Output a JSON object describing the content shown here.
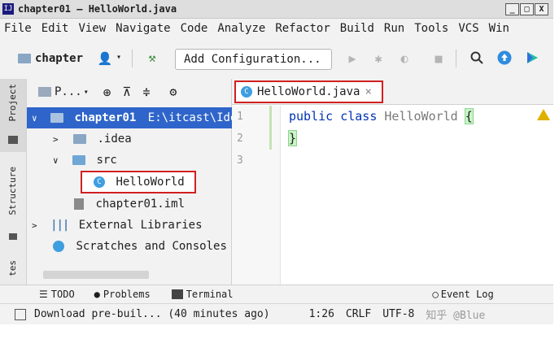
{
  "window": {
    "title": "chapter01 – HelloWorld.java",
    "min_label": "_",
    "max_label": "□",
    "close_label": "X"
  },
  "menu": [
    "File",
    "Edit",
    "View",
    "Navigate",
    "Code",
    "Analyze",
    "Refactor",
    "Build",
    "Run",
    "Tools",
    "VCS",
    "Win"
  ],
  "toolbar": {
    "project_label": "chapter",
    "run_config": "Add Configuration..."
  },
  "left_stripe": {
    "project": "Project",
    "structure": "Structure",
    "favorites": "tes"
  },
  "project_panel": {
    "view_selector": "P...",
    "tree": [
      {
        "label": "chapter01",
        "path": "E:\\itcast\\Ide"
      },
      {
        "label": ".idea"
      },
      {
        "label": "src"
      },
      {
        "label": "HelloWorld"
      },
      {
        "label": "chapter01.iml"
      },
      {
        "label": "External Libraries"
      },
      {
        "label": "Scratches and Consoles"
      }
    ]
  },
  "editor": {
    "tab_label": "HelloWorld.java",
    "tab_close": "×",
    "line_numbers": [
      "1",
      "2",
      "3"
    ],
    "code": {
      "kw1": "public",
      "kw2": "class",
      "name": "HelloWorld",
      "open": "{",
      "close": "}"
    }
  },
  "bottom_tools": {
    "todo": "TODO",
    "problems": "Problems",
    "terminal": "Terminal",
    "event_log": "Event Log"
  },
  "status": {
    "message": "Download pre-buil... (40 minutes ago)",
    "position": "1:26",
    "line_sep": "CRLF",
    "encoding": "UTF-8",
    "watermark": "知乎 @Blue"
  },
  "colors": {
    "accent": "#3f9ee0",
    "selection": "#2f65ca",
    "highlight_border": "#d12020",
    "warning": "#e0b000"
  }
}
